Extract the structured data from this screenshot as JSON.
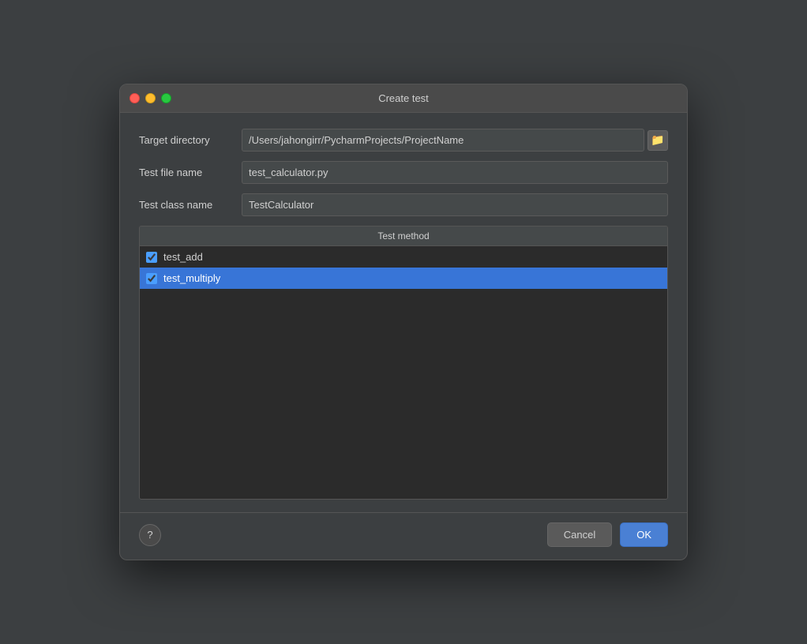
{
  "dialog": {
    "title": "Create test",
    "traffic_lights": {
      "close": "close",
      "minimize": "minimize",
      "maximize": "maximize"
    }
  },
  "form": {
    "target_directory": {
      "label": "Target directory",
      "value": "/Users/jahongirr/PycharmProjects/ProjectName"
    },
    "test_file_name": {
      "label": "Test file name",
      "value": "test_calculator.py"
    },
    "test_class_name": {
      "label": "Test class name",
      "value": "TestCalculator"
    }
  },
  "test_method": {
    "header": "Test method",
    "items": [
      {
        "name": "test_add",
        "checked": true,
        "selected": false
      },
      {
        "name": "test_multiply",
        "checked": true,
        "selected": true
      }
    ]
  },
  "footer": {
    "help_label": "?",
    "cancel_label": "Cancel",
    "ok_label": "OK"
  }
}
